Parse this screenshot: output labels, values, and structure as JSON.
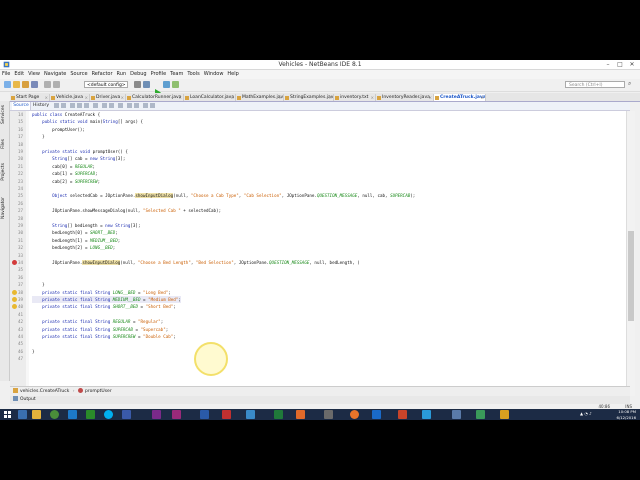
{
  "window": {
    "title": "Vehicles - NetBeans IDE 8.1"
  },
  "menu": [
    "File",
    "Edit",
    "View",
    "Navigate",
    "Source",
    "Refactor",
    "Run",
    "Debug",
    "Profile",
    "Team",
    "Tools",
    "Window",
    "Help"
  ],
  "toolbar": {
    "config_value": "<default config>",
    "search_placeholder": "Search (Ctrl+I)"
  },
  "tabs": [
    {
      "label": "Start Page",
      "active": false
    },
    {
      "label": "Vehicle.java",
      "active": false
    },
    {
      "label": "Driver.java",
      "active": false
    },
    {
      "label": "CalculatorRunner.java",
      "active": false
    },
    {
      "label": "LoanCalculator.java",
      "active": false
    },
    {
      "label": "MathExamples.java",
      "active": false
    },
    {
      "label": "StringExamples.java",
      "active": false
    },
    {
      "label": "inventory.txt",
      "active": false
    },
    {
      "label": "InventoryReader.java",
      "active": false
    },
    {
      "label": "CreateATruck.java",
      "active": true
    }
  ],
  "side_panels": [
    "Services",
    "Files",
    "Projects",
    "Navigator"
  ],
  "editor": {
    "source_tab": "Source",
    "history_tab": "History",
    "lines": [
      {
        "num": "14",
        "text": "public class CreateATruck {"
      },
      {
        "num": "15",
        "text": "    public static void main(String[] args) {"
      },
      {
        "num": "16",
        "text": "        promptUser();"
      },
      {
        "num": "17",
        "text": "    }"
      },
      {
        "num": "18",
        "text": ""
      },
      {
        "num": "19",
        "text": "    private static void promptUser() {"
      },
      {
        "num": "20",
        "text": "        String[] cab = new String[3];"
      },
      {
        "num": "21",
        "text": "        cab[0] = REGULAR;"
      },
      {
        "num": "22",
        "text": "        cab[1] = SUPERCAB;"
      },
      {
        "num": "23",
        "text": "        cab[2] = SUPERCREW;"
      },
      {
        "num": "24",
        "text": ""
      },
      {
        "num": "25",
        "text": "        Object selectedCab = JOptionPane.showInputDialog(null, \"Choose a Cab Type\", \"Cab Selection\", JOptionPane.QUESTION_MESSAGE, null, cab, SUPERCAB);"
      },
      {
        "num": "26",
        "text": ""
      },
      {
        "num": "27",
        "text": "        JOptionPane.showMessageDialog(null, \"Selected Cab \" + selectedCab);"
      },
      {
        "num": "28",
        "text": ""
      },
      {
        "num": "29",
        "text": "        String[] bedLength = new String[3];"
      },
      {
        "num": "30",
        "text": "        bedLength[0] = SHORT__BED;"
      },
      {
        "num": "31",
        "text": "        bedLength[1] = MEDIUM__BED;"
      },
      {
        "num": "32",
        "text": "        bedLength[2] = LONG__BED;"
      },
      {
        "num": "33",
        "text": ""
      },
      {
        "num": "34",
        "text": "        JOptionPane.showInputDialog(null, \"Choose a Bed Length\", \"Bed Selection\", JOptionPane.QUESTION_MESSAGE, null, bedLength, )"
      },
      {
        "num": "35",
        "text": ""
      },
      {
        "num": "36",
        "text": ""
      },
      {
        "num": "37",
        "text": "    }"
      },
      {
        "num": "38",
        "text": "    private static final String LONG__BED = \"Long Bed\";"
      },
      {
        "num": "39",
        "text": "    private static final String MEDIUM__BED = \"Medium Bed\";"
      },
      {
        "num": "40",
        "text": "    private static final String SHORT__BED = \"Short Bed\";"
      },
      {
        "num": "41",
        "text": ""
      },
      {
        "num": "42",
        "text": "    private static final String REGULAR = \"Regular\";"
      },
      {
        "num": "43",
        "text": "    private static final String SUPERCAB = \"Supercab\";"
      },
      {
        "num": "44",
        "text": "    private static final String SUPERCREW = \"Double Cab\";"
      },
      {
        "num": "45",
        "text": ""
      },
      {
        "num": "46",
        "text": "}"
      },
      {
        "num": "47",
        "text": ""
      }
    ]
  },
  "navigator_bar": {
    "crumb_class": "vehicles.CreateATruck",
    "crumb_method": "promptUser"
  },
  "output_tab": "Output",
  "status": {
    "caret": "40:86",
    "mode": "INS"
  },
  "clock": {
    "time": "10:08 PM",
    "date": "6/12/2016"
  },
  "colors": {
    "keyword": "#1a2bb0",
    "string": "#ca5d00",
    "constant": "#1a8a1a",
    "active_tab": "#1c57c8",
    "taskbar": "#1c2b45"
  }
}
